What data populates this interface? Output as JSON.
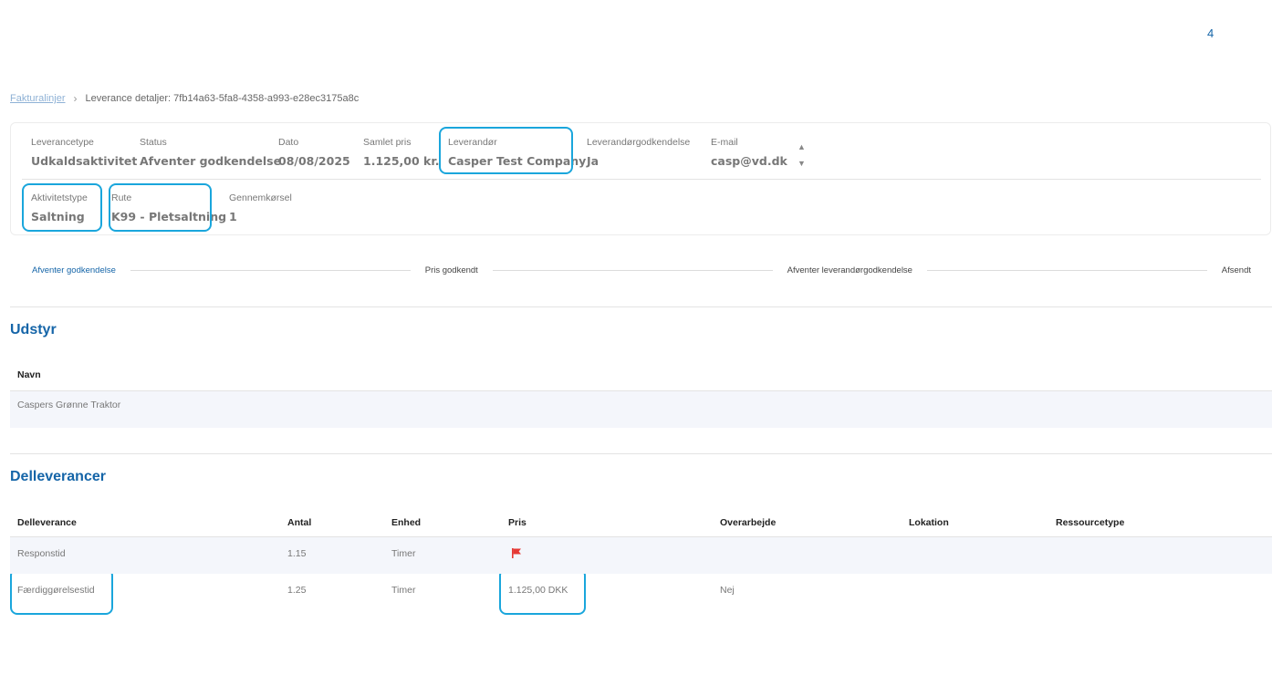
{
  "page_number": "4",
  "breadcrumb": {
    "link": "Fakturalinjer",
    "current": "Leverance detaljer: 7fb14a63-5fa8-4358-a993-e28ec3175a8c"
  },
  "details": {
    "leverancetype": {
      "label": "Leverancetype",
      "value": "Udkaldsaktivitet"
    },
    "status": {
      "label": "Status",
      "value": "Afventer godkendelse"
    },
    "dato": {
      "label": "Dato",
      "value": "08/08/2025"
    },
    "samlet_pris": {
      "label": "Samlet pris",
      "value": "1.125,00 kr."
    },
    "leverandor": {
      "label": "Leverandør",
      "value": "Casper Test Company"
    },
    "leverandorgodkendelse": {
      "label": "Leverandørgodkendelse",
      "value": "Ja"
    },
    "email": {
      "label": "E-mail",
      "value": "casp@vd.dk"
    },
    "aktivitetstype": {
      "label": "Aktivitetstype",
      "value": "Saltning"
    },
    "rute": {
      "label": "Rute",
      "value": "K99 - Pletsaltning"
    },
    "gennemkorsel": {
      "label": "Gennemkørsel",
      "value": "1"
    }
  },
  "stepper": [
    {
      "label": "Afventer godkendelse",
      "active": true
    },
    {
      "label": "Pris godkendt",
      "active": false
    },
    {
      "label": "Afventer leverandørgodkendelse",
      "active": false
    },
    {
      "label": "Afsendt",
      "active": false
    }
  ],
  "udstyr": {
    "title": "Udstyr",
    "columns": [
      "Navn"
    ],
    "rows": [
      [
        "Caspers Grønne Traktor"
      ]
    ]
  },
  "delleverancer": {
    "title": "Delleverancer",
    "columns": [
      "Delleverance",
      "Antal",
      "Enhed",
      "Pris",
      "Overarbejde",
      "Lokation",
      "Ressourcetype"
    ],
    "rows": [
      [
        "Responstid",
        "1.15",
        "Timer",
        "",
        "",
        "",
        ""
      ],
      [
        "Færdiggørelsestid",
        "1.25",
        "Timer",
        "1.125,00 DKK",
        "Nej",
        "",
        ""
      ]
    ]
  },
  "icons": {
    "flag": "flag-icon",
    "sort": "sort-arrows-icon"
  },
  "colors": {
    "accent": "#1565a8",
    "highlight": "#1aa6dc",
    "flag": "#e53935"
  }
}
